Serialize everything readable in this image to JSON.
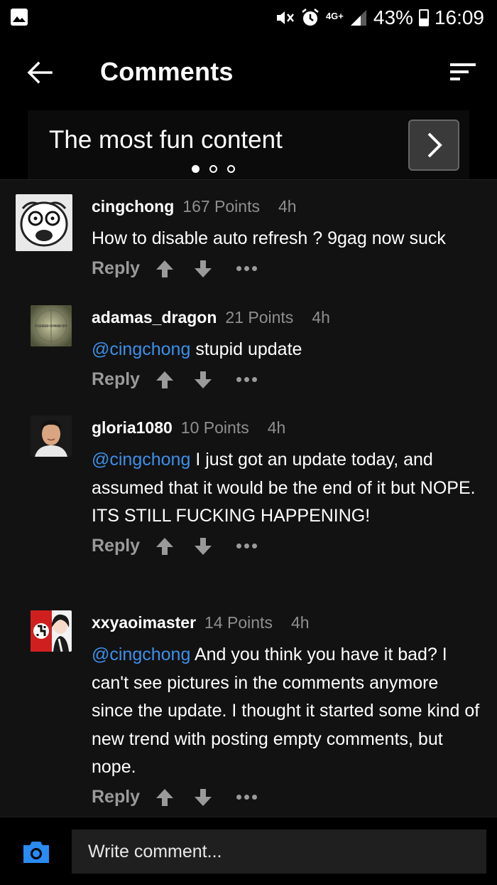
{
  "status_bar": {
    "signal": "4G+",
    "battery": "43%",
    "time": "16:09",
    "icons": [
      "image-icon",
      "mute-icon",
      "alarm-icon",
      "signal-icon",
      "battery-icon"
    ]
  },
  "header": {
    "title": "Comments",
    "back_icon": "arrow-left-icon",
    "sort_icon": "sort-icon"
  },
  "banner": {
    "text": "The most fun content",
    "next_icon": "chevron-right-icon",
    "page_count": 3,
    "active_page": 1
  },
  "comments": [
    {
      "user": "cingchong",
      "points": "167 Points",
      "time": "4h",
      "mention": "",
      "text": "How to disable auto refresh ? 9gag now suck",
      "reply": "Reply"
    },
    {
      "user": "adamas_dragon",
      "points": "21 Points",
      "time": "4h",
      "mention": "@cingchong",
      "text": "stupid update",
      "reply": "Reply",
      "avatar_text": "PLEASE STAND BY"
    },
    {
      "user": "gloria1080",
      "points": "10 Points",
      "time": "4h",
      "mention": "@cingchong",
      "text": "I just got an update today, and assumed that it would be the end of it but NOPE.",
      "text2": "ITS STILL FUCKING HAPPENING!",
      "reply": "Reply"
    },
    {
      "user": "xxyaoimaster",
      "points": "14 Points",
      "time": "4h",
      "mention": "@cingchong",
      "text": "And you think you have it bad? I can't see pictures in the comments anymore since the update. I thought it started some kind of new trend with posting empty comments, but nope.",
      "reply": "Reply"
    }
  ],
  "footer": {
    "placeholder": "Write comment...",
    "camera_icon": "camera-icon"
  },
  "colors": {
    "accent": "#3d8fe9",
    "background": "#121212",
    "muted": "#8f8f8f"
  }
}
